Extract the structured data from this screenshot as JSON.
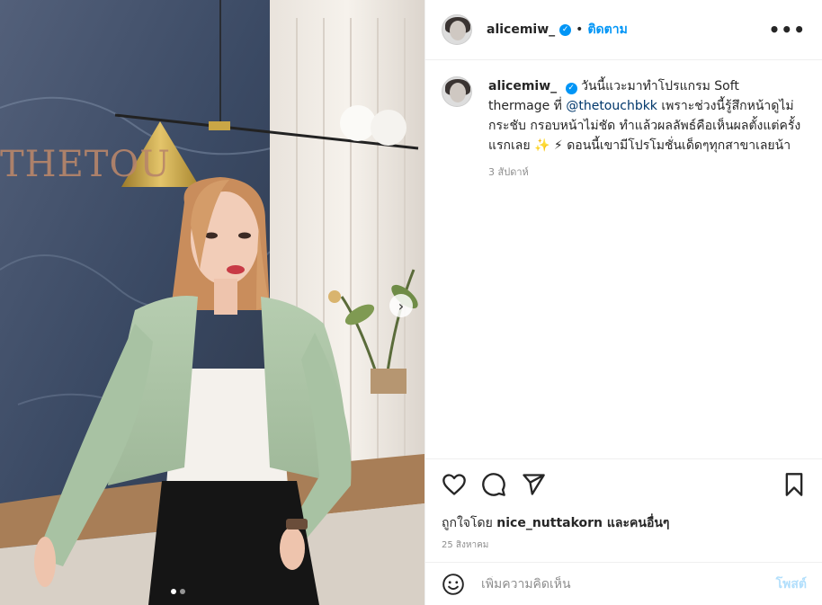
{
  "header": {
    "username": "alicemiw_",
    "separator": "•",
    "follow_label": "ติดตาม",
    "more_label": "•••"
  },
  "photo": {
    "wordmark": "THETOU",
    "next_glyph": "›",
    "slide_count": 2,
    "active_slide": 1
  },
  "caption": {
    "username": "alicemiw_",
    "text_part1": "วันนี้แวะมาทำโปรแกรม Soft thermage ที่ ",
    "mention": "@thetouchbkk",
    "text_part2": " เพราะช่วงนี้รู้สึกหน้าดูไม่กระชับ กรอบหน้าไม่ชัด ทำแล้วผลลัพธ์คือเห็นผลตั้งแต่ครั้งแรกเลย ✨ ⚡ ดอนนี้เขามีโปรโมชั่นเด็ดๆทุกสาขาเลยน้า",
    "time": "3 สัปดาห์"
  },
  "actions": {
    "icons": [
      "heart-icon",
      "comment-icon",
      "share-icon",
      "bookmark-icon"
    ],
    "likes_prefix": "ถูกใจโดย ",
    "likes_user": "nice_nuttakorn",
    "likes_suffix": " และคนอื่นๆ",
    "date": "25 สิงหาคม"
  },
  "comment": {
    "placeholder": "เพิ่มความคิดเห็น",
    "post_label": "โพสต์"
  },
  "colors": {
    "accent": "#0095f6",
    "mention": "#00376b",
    "post_disabled": "#b2dffc"
  }
}
